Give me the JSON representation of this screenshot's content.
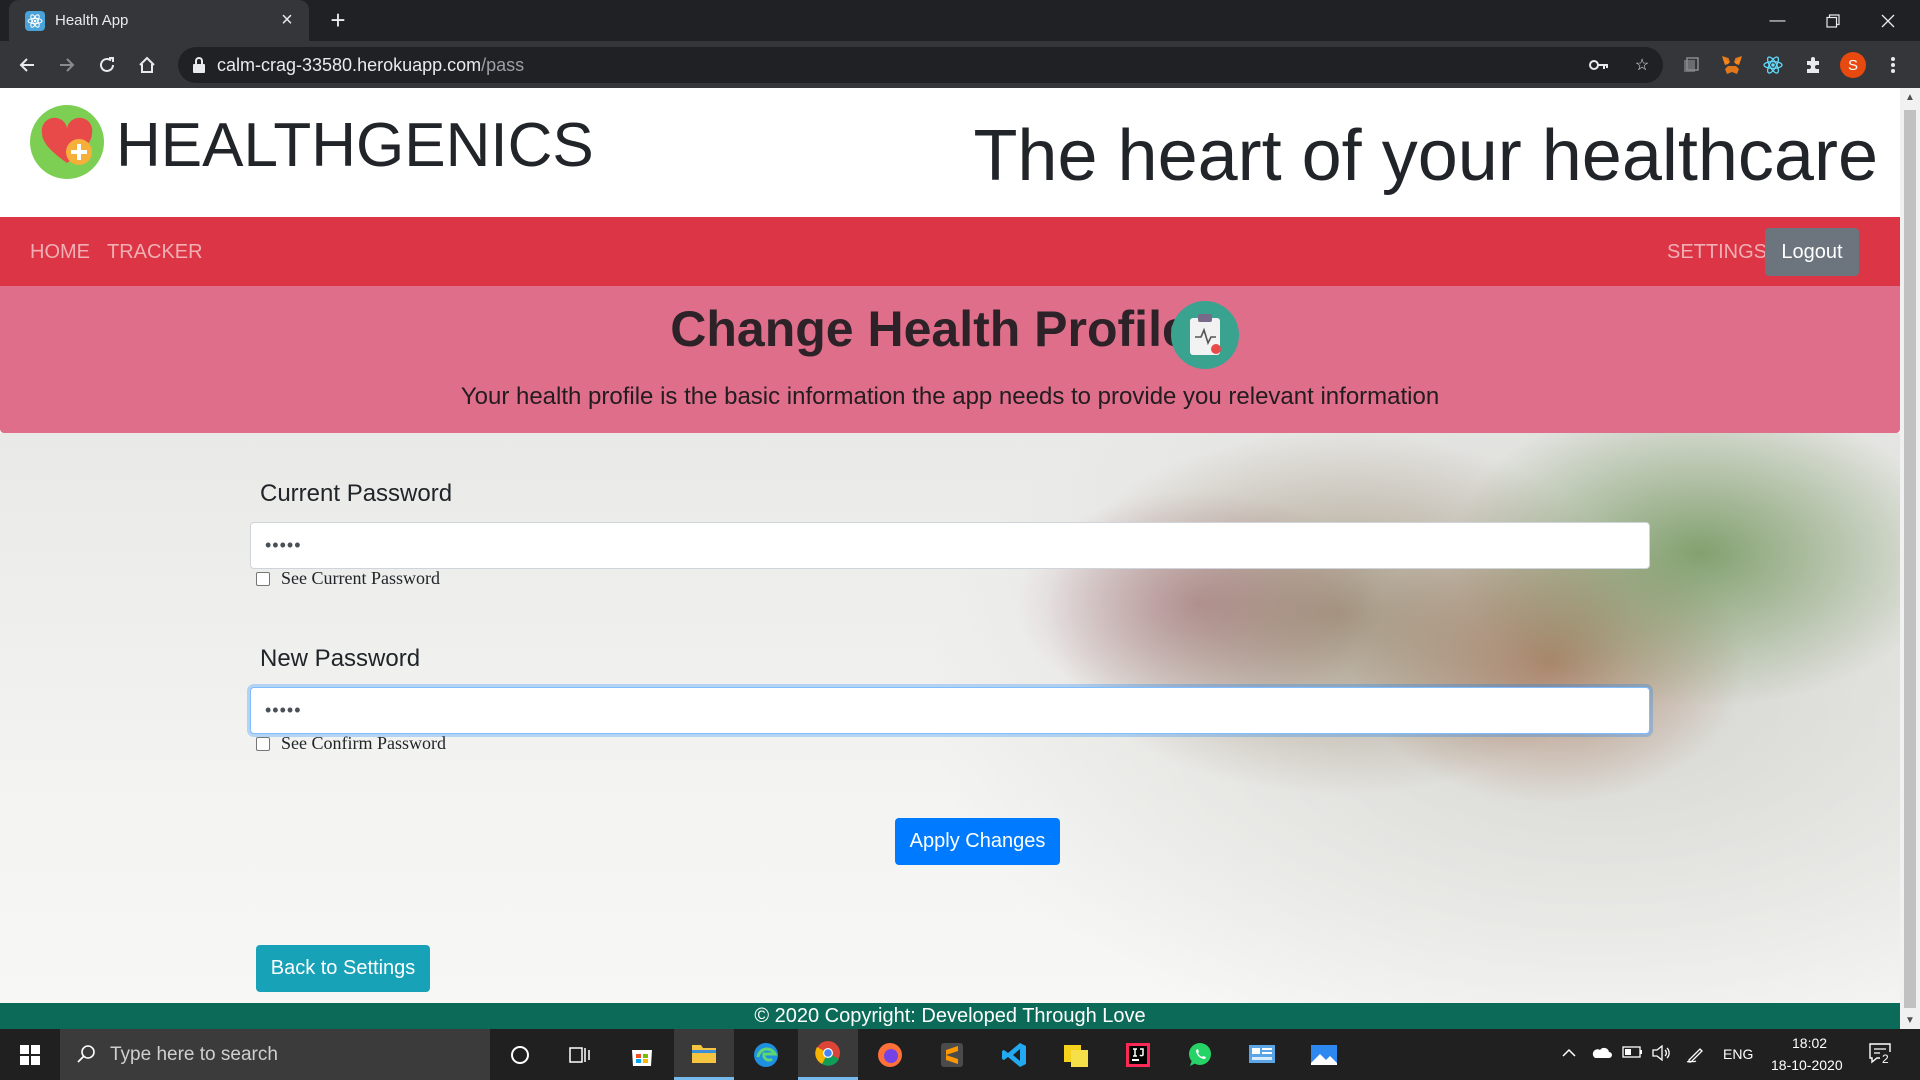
{
  "browser": {
    "tab_title": "Health App",
    "url_host": "calm-crag-33580.herokuapp.com",
    "url_path": "/pass",
    "profile_initial": "S"
  },
  "header": {
    "brand": "HEALTHGENICS",
    "tagline": "The heart of your healthcare"
  },
  "navbar": {
    "links": [
      "HOME",
      "TRACKER"
    ],
    "settings": "SETTINGS",
    "logout": "Logout"
  },
  "hero": {
    "title": "Change Health Profile",
    "subtitle": "Your health profile is the basic information the app needs to provide you relevant information"
  },
  "form": {
    "current_password": {
      "label": "Current Password",
      "value": "•••••",
      "checkbox_label": "See Current Password",
      "checked": false
    },
    "new_password": {
      "label": "New Password",
      "value": "•••••",
      "checkbox_label": "See Confirm Password",
      "checked": false
    },
    "apply_label": "Apply Changes",
    "back_label": "Back to Settings"
  },
  "footer": {
    "text": "© 2020 Copyright: Developed Through Love"
  },
  "taskbar": {
    "search_placeholder": "Type here to search",
    "language": "ENG",
    "time": "18:02",
    "date": "18-10-2020",
    "notification_count": "2"
  },
  "colors": {
    "navbar": "#dc3545",
    "hero": "#de6e8a",
    "footer": "#0c6b58",
    "apply": "#007bff",
    "back": "#17a2b8",
    "logout": "#6c757d"
  }
}
